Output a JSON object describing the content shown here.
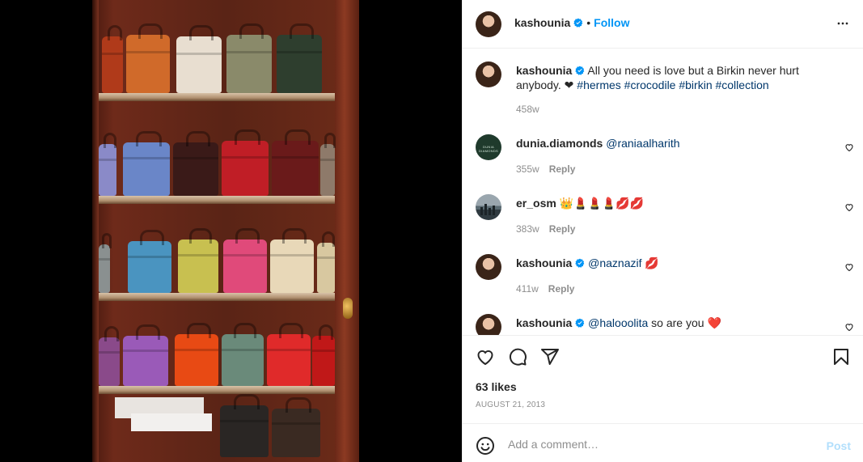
{
  "post": {
    "author": "kashounia",
    "follow_label": "Follow",
    "separator": "•",
    "caption": {
      "username": "kashounia",
      "text": "All you need is love but a Birkin never hurt anybody. ❤ ",
      "tags": "#hermes #crocodile #birkin #collection",
      "time": "458w"
    },
    "comments": [
      {
        "username": "dunia.diamonds",
        "text": "",
        "mention": "@raniaalharith",
        "time": "355w",
        "reply_label": "Reply",
        "avatar_text": "DUNIA DIAMONDS"
      },
      {
        "username": "er_osm",
        "text": "👑💄💄💄💋💋",
        "mention": "",
        "time": "383w",
        "reply_label": "Reply"
      },
      {
        "username": "kashounia",
        "text": "💋",
        "mention": "@naznazif ",
        "time": "411w",
        "reply_label": "Reply"
      },
      {
        "username": "kashounia",
        "text": " so are you ❤️",
        "mention": "@halooolita",
        "time": "",
        "reply_label": ""
      }
    ],
    "likes": "63 likes",
    "date": "AUGUST 21, 2013",
    "comment_placeholder": "Add a comment…",
    "post_label": "Post"
  },
  "colors": {
    "link": "#0095f6",
    "mention": "#00376b",
    "muted": "#8e8e8e",
    "post_disabled": "#b2dffc"
  },
  "icons": [
    "verified-badge-icon",
    "more-options-icon",
    "heart-icon",
    "comment-icon",
    "share-icon",
    "bookmark-icon",
    "emoji-icon"
  ]
}
